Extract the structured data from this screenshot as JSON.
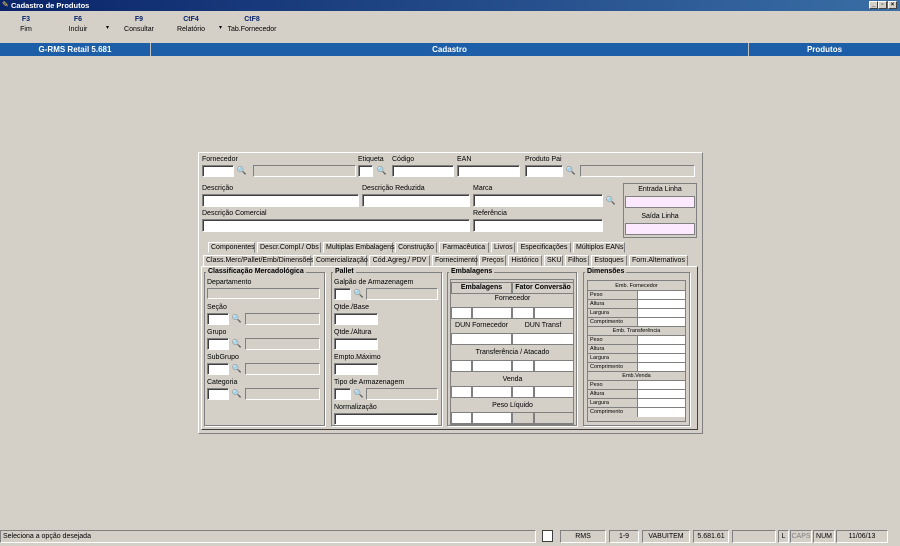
{
  "window": {
    "title": "Cadastro de Produtos"
  },
  "toolbar": [
    {
      "key": "F3",
      "label": "Fim"
    },
    {
      "key": "F6",
      "label": "Incluir"
    },
    {
      "key": "F9",
      "label": "Consultar"
    },
    {
      "key": "CtF4",
      "label": "Relatório"
    },
    {
      "key": "CtF8",
      "label": "Tab.Fornecedor"
    }
  ],
  "header": {
    "app": "G-RMS Retail 5.681",
    "section": "Cadastro",
    "module": "Produtos"
  },
  "form": {
    "fornecedor": "Fornecedor",
    "etiqueta": "Etiqueta",
    "codigo": "Código",
    "ean": "EAN",
    "produto_pai": "Produto Pai",
    "descricao": "Descrição",
    "descricao_reduzida": "Descrição Reduzida",
    "marca": "Marca",
    "descricao_comercial": "Descrição Comercial",
    "referencia": "Referência",
    "entrada_linha": "Entrada Linha",
    "saida_linha": "Saída Linha"
  },
  "tabs_row1": [
    "Componentes",
    "Descr.Compl./ Obs",
    "Multiplas Embalagens",
    "Construção",
    "Farmacêutica",
    "Livros",
    "Especificações",
    "Múltiplos EANs"
  ],
  "tabs_row2": [
    "Class.Merc/Pallet/Emb/Dimensões",
    "Comercialização",
    "Cód.Agreg./ PDV",
    "Fornecimento",
    "Preços",
    "Histórico",
    "SKU",
    "Filhos",
    "Estoques",
    "Forn.Alternativos"
  ],
  "classificacao": {
    "title": "Classificação Mercadológica",
    "departamento": "Departamento",
    "secao": "Seção",
    "grupo": "Grupo",
    "subgrupo": "SubGrupo",
    "categoria": "Categoria"
  },
  "pallet": {
    "title": "Pallet",
    "galpao": "Galpão de Armazenagem",
    "qtde_base": "Qtde./Base",
    "qtde_altura": "Qtde./Altura",
    "empto_maximo": "Empto.Máximo",
    "tipo_armazenagem": "Tipo de Armazenagem",
    "normalizacao": "Normalização"
  },
  "embalagens": {
    "title": "Embalagens",
    "col1": "Embalagens",
    "col2": "Fator Conversão",
    "fornecedor": "Fornecedor",
    "dun_fornecedor": "DUN Fornecedor",
    "dun_transf": "DUN Transf",
    "transferencia": "Transferência / Atacado",
    "venda": "Venda",
    "peso_liquido": "Peso Líquido"
  },
  "dimensoes": {
    "title": "Dimensões",
    "sections": [
      {
        "title": "Emb. Fornecedor",
        "rows": [
          "Peso",
          "Altura",
          "Largura",
          "Comprimento"
        ]
      },
      {
        "title": "Emb. Transferência",
        "rows": [
          "Peso",
          "Altura",
          "Largura",
          "Comprimento"
        ]
      },
      {
        "title": "Emb.Venda",
        "rows": [
          "Peso",
          "Altura",
          "Largura",
          "Comprimento"
        ]
      }
    ]
  },
  "status": {
    "message": "Seleciona a opção desejada",
    "rms": "RMS",
    "pos": "1-9",
    "user": "VABUITEM",
    "version": "5.681.61",
    "l": "L",
    "caps": "CAPS",
    "num": "NUM",
    "date": "11/06/13"
  },
  "colors": {
    "header": "#1c5fa8",
    "titlebar": "#0a246a",
    "face": "#d4d0c8"
  }
}
